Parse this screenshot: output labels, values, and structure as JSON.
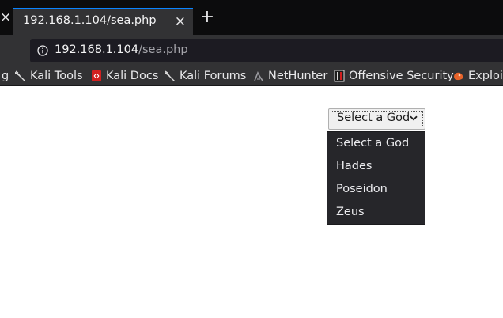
{
  "tabs": {
    "prev_close_glyph": "×",
    "active": {
      "title": "192.168.1.104/sea.php",
      "close_glyph": "×"
    },
    "new_tab_glyph": "+"
  },
  "urlbar": {
    "host": "192.168.1.104",
    "path": "/sea.php",
    "icon": "info-icon"
  },
  "bookmarks": [
    {
      "label": "g",
      "icon": "none"
    },
    {
      "label": "Kali Tools",
      "icon": "kali-dragon-icon"
    },
    {
      "label": "Kali Docs",
      "icon": "kali-docs-icon"
    },
    {
      "label": "Kali Forums",
      "icon": "kali-dragon-icon"
    },
    {
      "label": "NetHunter",
      "icon": "nethunter-icon"
    },
    {
      "label": "Offensive Security",
      "icon": "offensive-security-icon"
    },
    {
      "label": "Exploit",
      "icon": "exploit-db-icon"
    }
  ],
  "god_select": {
    "selected": "Select a God",
    "options": [
      "Select a God",
      "Hades",
      "Poseidon",
      "Zeus"
    ]
  },
  "colors": {
    "tabstrip_bg": "#0c0c0d",
    "toolbar_bg": "#323234",
    "accent": "#0a84ff",
    "dropdown_bg": "#26262a",
    "kali_docs_red": "#d21f1f",
    "exploit_orange": "#e8642b"
  }
}
